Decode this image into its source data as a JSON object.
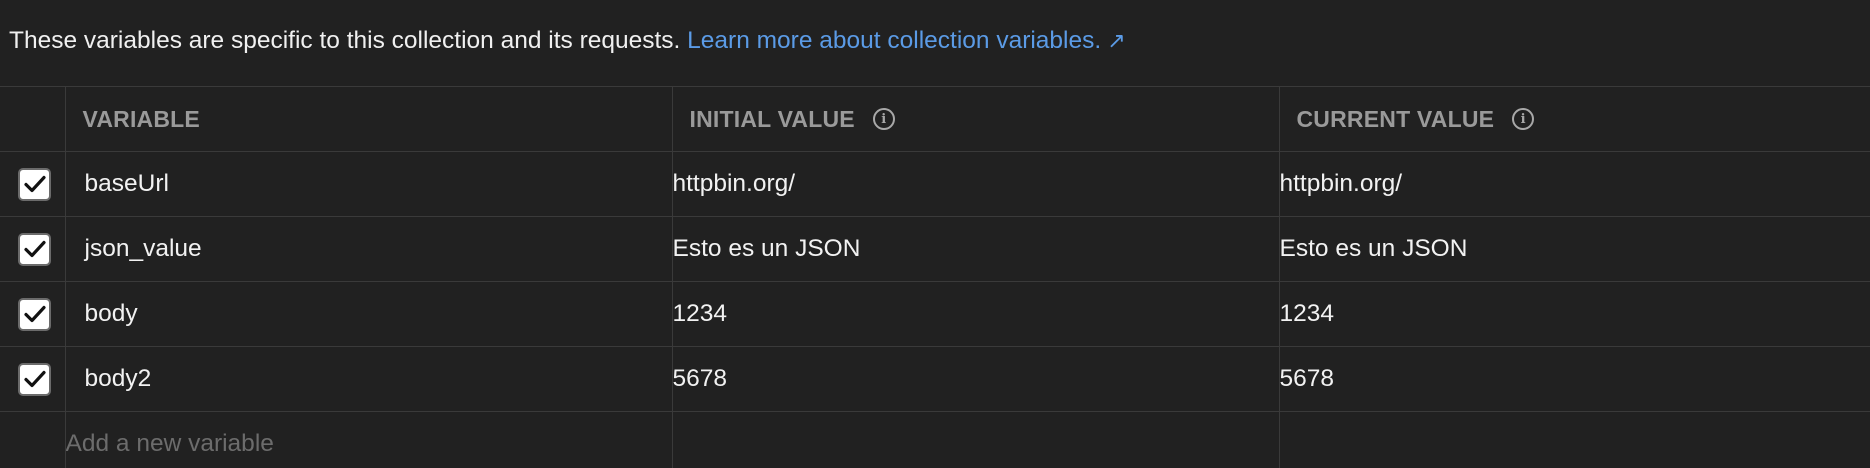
{
  "intro": {
    "text": "These variables are specific to this collection and its requests.",
    "link": "Learn more about collection variables.",
    "link_arrow": "↗"
  },
  "table": {
    "headers": {
      "variable": "VARIABLE",
      "initial_value": "INITIAL VALUE",
      "current_value": "CURRENT VALUE"
    },
    "rows": [
      {
        "enabled": true,
        "variable": "baseUrl",
        "initial": "httpbin.org/",
        "current": "httpbin.org/"
      },
      {
        "enabled": true,
        "variable": "json_value",
        "initial": "Esto es un JSON",
        "current": "Esto es un JSON"
      },
      {
        "enabled": true,
        "variable": "body",
        "initial": "1234",
        "current": "1234"
      },
      {
        "enabled": true,
        "variable": "body2",
        "initial": "5678",
        "current": "5678"
      }
    ],
    "new_variable_placeholder": "Add a new variable"
  },
  "colors": {
    "background": "#212121",
    "link": "#5b9be6",
    "border": "#3a3a3a",
    "header_text": "#9a9a9a"
  },
  "icons": {
    "info": "info-icon",
    "checkbox": "checkbox-checked-icon",
    "external_link": "arrow-up-right-icon"
  }
}
